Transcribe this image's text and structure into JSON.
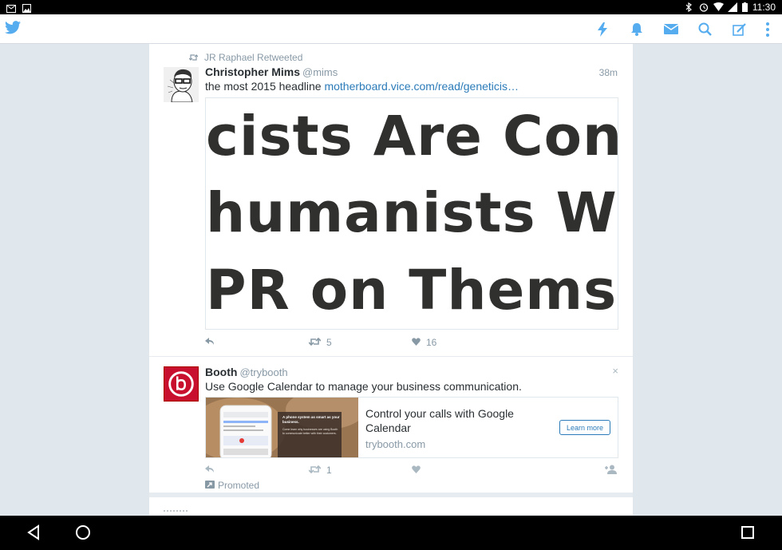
{
  "status_bar": {
    "time": "11:30",
    "icons": [
      "gmail-icon",
      "photos-icon",
      "bluetooth-icon",
      "alarm-icon",
      "wifi-icon",
      "signal-icon",
      "battery-icon"
    ]
  },
  "app_bar": {
    "accent": "#55acee",
    "actions": [
      "lightning-icon",
      "bell-icon",
      "envelope-icon",
      "search-icon",
      "compose-icon",
      "overflow-menu-icon"
    ]
  },
  "timeline": {
    "tweets": [
      {
        "retweeted_by": "JR Raphael Retweeted",
        "name": "Christopher Mims",
        "handle": "@mims",
        "time": "38m",
        "text": "the most 2015 headline ",
        "link": "motherboard.vice.com/read/geneticis…",
        "media_lines": [
          "cists Are Con",
          "humanists W",
          "PR on Themse"
        ],
        "retweets": "5",
        "likes": "16"
      },
      {
        "name": "Booth",
        "handle": "@trybooth",
        "dismiss": "×",
        "text": "Use Google Calendar to manage your business communication.",
        "card": {
          "title": "Control your calls with Google Calendar",
          "domain": "trybooth.com",
          "button": "Learn more",
          "image_heading": "A phone system as smart as your business.",
          "image_body": "Come learn why businesses are using Booth to communicate better with their customers."
        },
        "retweets": "1",
        "promoted": "Promoted"
      }
    ]
  }
}
